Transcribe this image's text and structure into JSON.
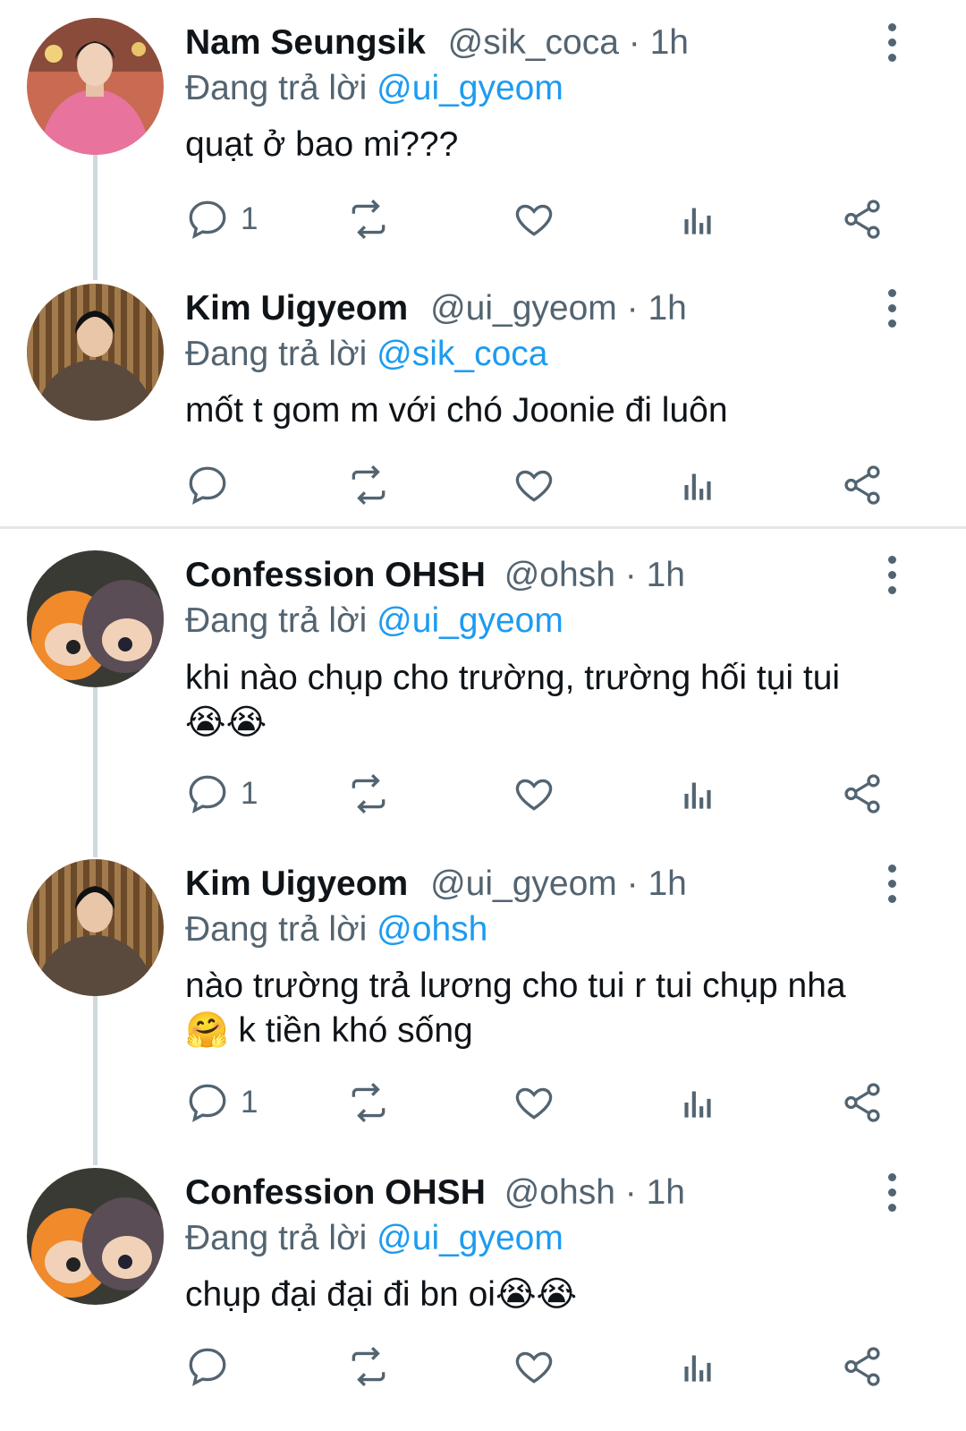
{
  "tweets": [
    {
      "name": "Nam Seungsik",
      "handle": "@sik_coca",
      "time": "1h",
      "reply_prefix": "Đang trả lời",
      "reply_to": "@ui_gyeom",
      "text": "quạt ở bao mi???",
      "replies": "1"
    },
    {
      "name": "Kim Uigyeom",
      "handle": "@ui_gyeom",
      "time": "1h",
      "reply_prefix": "Đang trả lời",
      "reply_to": "@sik_coca",
      "text": "mốt t gom m với chó Joonie đi luôn",
      "replies": ""
    },
    {
      "name": "Confession OHSH",
      "handle": "@ohsh",
      "time": "1h",
      "reply_prefix": "Đang trả lời",
      "reply_to": "@ui_gyeom",
      "text": "khi nào chụp cho trường, trường hối tụi tui",
      "replies": "1",
      "emojis": "😭😭"
    },
    {
      "name": "Kim Uigyeom",
      "handle": "@ui_gyeom",
      "time": "1h",
      "reply_prefix": "Đang trả lời",
      "reply_to": "@ohsh",
      "text": "nào trường trả lương cho tui r tui chụp nha",
      "text2": "k tiền khó sống",
      "replies": "1",
      "emojis": "🤗"
    },
    {
      "name": "Confession OHSH",
      "handle": "@ohsh",
      "time": "1h",
      "reply_prefix": "Đang trả lời",
      "reply_to": "@ui_gyeom",
      "text": "chụp đại đại đi bn oi",
      "replies": "",
      "emojis": "😭😭"
    }
  ],
  "separator_dot": "·",
  "colors": {
    "text": "#0f1419",
    "secondary": "#536471",
    "link": "#1d9bf0",
    "thread": "#cfd9de"
  }
}
